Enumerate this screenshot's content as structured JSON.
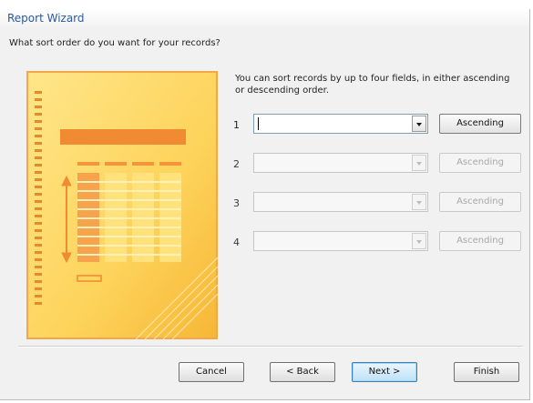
{
  "dialog": {
    "title": "Report Wizard",
    "question": "What sort order do you want for your records?",
    "info": "You can sort records by up to four fields, in either ascending or descending order."
  },
  "sort_rows": [
    {
      "number": "1",
      "field": "",
      "order": "Ascending",
      "enabled": true
    },
    {
      "number": "2",
      "field": "",
      "order": "Ascending",
      "enabled": false
    },
    {
      "number": "3",
      "field": "",
      "order": "Ascending",
      "enabled": false
    },
    {
      "number": "4",
      "field": "",
      "order": "Ascending",
      "enabled": false
    }
  ],
  "buttons": {
    "cancel": "Cancel",
    "back": "< Back",
    "next": "Next >",
    "finish": "Finish"
  },
  "colors": {
    "illustration_bg": "#fdd35a",
    "illustration_accent": "#f08a33",
    "title_text": "#2b5a9e",
    "primary_button": "#bfe2f7"
  }
}
